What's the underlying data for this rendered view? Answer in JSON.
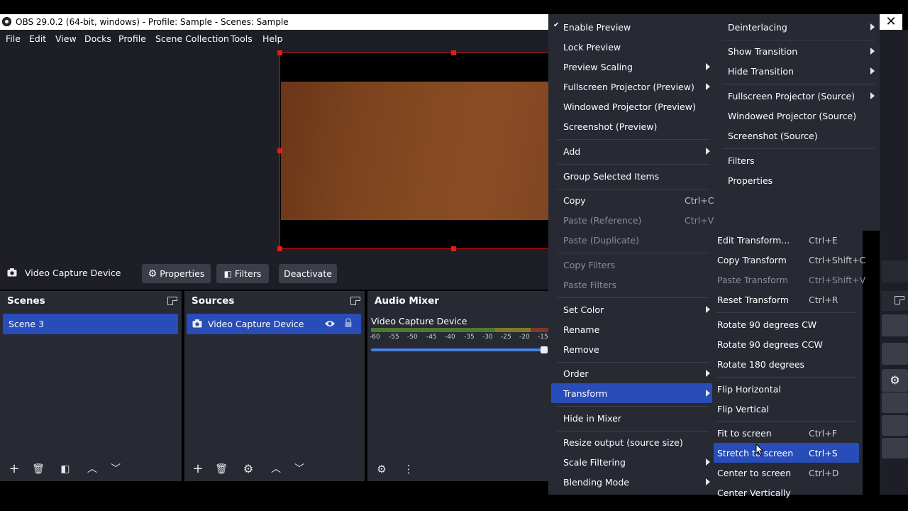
{
  "window": {
    "title": "OBS 29.0.2 (64-bit, windows) - Profile: Sample - Scenes: Sample",
    "close_glyph": "✕"
  },
  "menubar": [
    "File",
    "Edit",
    "View",
    "Docks",
    "Profile",
    "Scene Collection",
    "Tools",
    "Help"
  ],
  "context_bar": {
    "source_name": "Video Capture Device",
    "properties": "Properties",
    "filters": "Filters",
    "deactivate": "Deactivate"
  },
  "scenes": {
    "title": "Scenes",
    "items": [
      "Scene 3"
    ]
  },
  "sources": {
    "title": "Sources",
    "items": [
      "Video Capture Device"
    ]
  },
  "mixer": {
    "title": "Audio Mixer",
    "channel": "Video Capture Device",
    "scale": [
      "-60",
      "-55",
      "-50",
      "-45",
      "-40",
      "-35",
      "-30",
      "-25",
      "-20",
      "-15"
    ]
  },
  "context_menu": {
    "enable_preview": "Enable Preview",
    "lock_preview": "Lock Preview",
    "preview_scaling": "Preview Scaling",
    "fullscreen_projector_preview": "Fullscreen Projector (Preview)",
    "windowed_projector_preview": "Windowed Projector (Preview)",
    "screenshot_preview": "Screenshot (Preview)",
    "add": "Add",
    "group_selected": "Group Selected Items",
    "copy": "Copy",
    "copy_sc": "Ctrl+C",
    "paste_reference": "Paste (Reference)",
    "paste_reference_sc": "Ctrl+V",
    "paste_duplicate": "Paste (Duplicate)",
    "copy_filters": "Copy Filters",
    "paste_filters": "Paste Filters",
    "set_color": "Set Color",
    "rename": "Rename",
    "remove": "Remove",
    "order": "Order",
    "transform": "Transform",
    "hide_in_mixer": "Hide in Mixer",
    "resize_output": "Resize output (source size)",
    "scale_filtering": "Scale Filtering",
    "blending_mode": "Blending Mode"
  },
  "source_menu": {
    "deinterlacing": "Deinterlacing",
    "show_transition": "Show Transition",
    "hide_transition": "Hide Transition",
    "fullscreen_projector_source": "Fullscreen Projector (Source)",
    "windowed_projector_source": "Windowed Projector (Source)",
    "screenshot_source": "Screenshot (Source)",
    "filters": "Filters",
    "properties": "Properties"
  },
  "transform_menu": {
    "edit_transform": "Edit Transform...",
    "edit_transform_sc": "Ctrl+E",
    "copy_transform": "Copy Transform",
    "copy_transform_sc": "Ctrl+Shift+C",
    "paste_transform": "Paste Transform",
    "paste_transform_sc": "Ctrl+Shift+V",
    "reset_transform": "Reset Transform",
    "reset_transform_sc": "Ctrl+R",
    "rotate_cw": "Rotate 90 degrees CW",
    "rotate_ccw": "Rotate 90 degrees CCW",
    "rotate_180": "Rotate 180 degrees",
    "flip_h": "Flip Horizontal",
    "flip_v": "Flip Vertical",
    "fit_to_screen": "Fit to screen",
    "fit_to_screen_sc": "Ctrl+F",
    "stretch_to_screen": "Stretch to screen",
    "stretch_to_screen_sc": "Ctrl+S",
    "center_to_screen": "Center to screen",
    "center_to_screen_sc": "Ctrl+D",
    "center_vertically": "Center Vertically"
  },
  "colors": {
    "accent": "#284cb8",
    "selection_border": "#d41111",
    "panel_bg": "#272a33",
    "app_bg": "#1e1f26"
  }
}
